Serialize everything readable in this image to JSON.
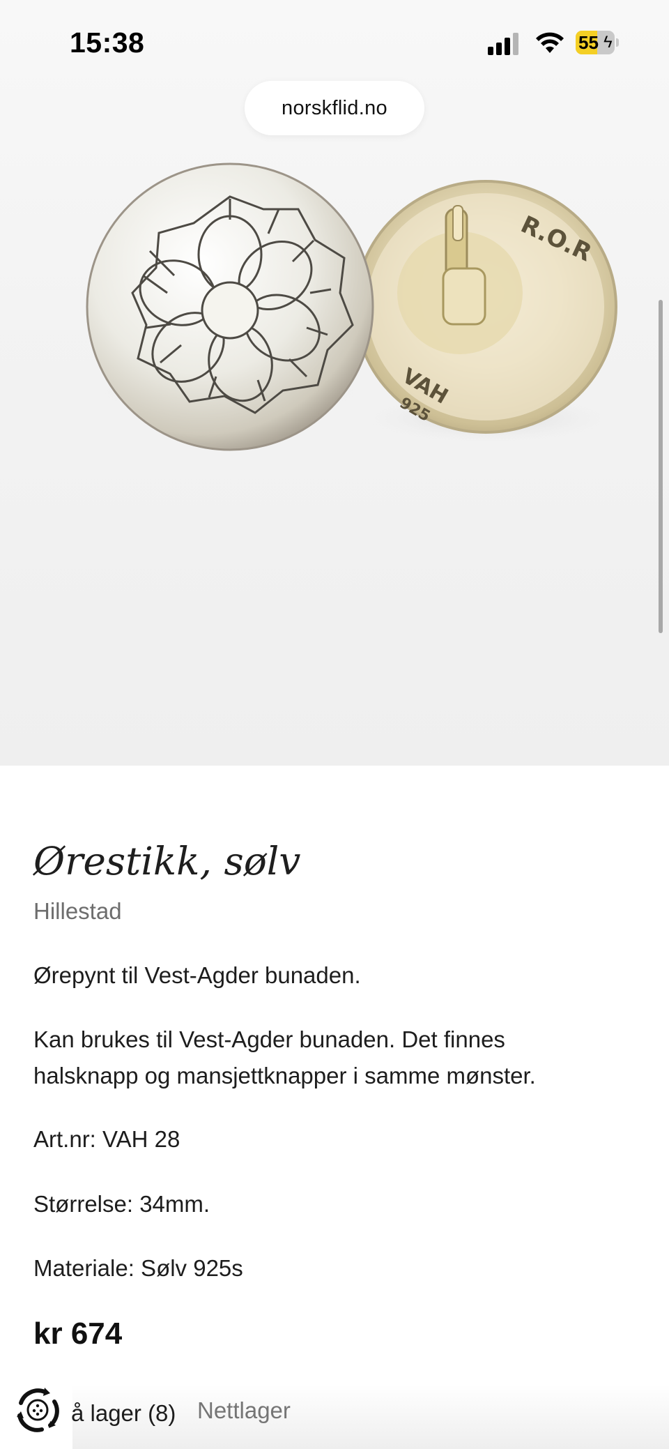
{
  "status_bar": {
    "time": "15:38",
    "battery_level": "55",
    "battery_fraction": 0.55,
    "battery_charging": true,
    "signal_icon": "cellular-signal-icon",
    "wifi_icon": "wifi-icon",
    "battery_color": "#f4cf25"
  },
  "browser": {
    "url": "norskflid.no"
  },
  "product": {
    "image_alt_icon": "product-photo",
    "title": "Ørestikk, sølv",
    "brand": "Hillestad",
    "description": [
      "Ørepynt til Vest-Agder bunaden.",
      "Kan brukes til Vest-Agder bunaden. Det finnes",
      "halsknapp og mansjettknapper i samme mønster.",
      "Art.nr: VAH 28",
      "Størrelse: 34mm.",
      "Materiale: Sølv 925s"
    ],
    "price": "kr 674",
    "stock": {
      "label": "å lager (8)",
      "online_label": "Nettlager",
      "icon": "loading-spinner-icon"
    }
  }
}
